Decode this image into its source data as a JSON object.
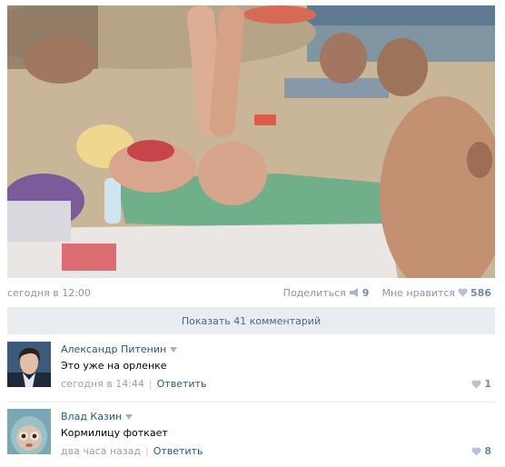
{
  "post": {
    "time": "сегодня в 12:00",
    "share_label": "Поделиться",
    "share_count": "9",
    "like_label": "Мне нравится",
    "like_count": "586"
  },
  "show_comments_label": "Показать 41 комментарий",
  "comments": [
    {
      "author": "Александр Питенин",
      "text": "Это уже на орленке",
      "time": "сегодня в 14:44",
      "reply_label": "Ответить",
      "likes": "1"
    },
    {
      "author": "Влад Казин",
      "text": "Кормилицу фоткает",
      "time": "два часа назад",
      "reply_label": "Ответить",
      "likes": "8"
    }
  ],
  "icons": {
    "share": "megaphone-icon",
    "like": "heart-icon",
    "expand": "triangle-down-icon"
  },
  "colors": {
    "link": "#2b587a",
    "meta": "#8a96a8",
    "count": "#7589a3",
    "button_bg": "#e9edf1"
  }
}
